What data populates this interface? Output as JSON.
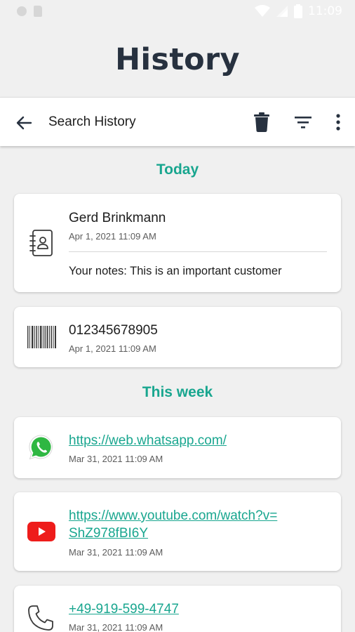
{
  "status_bar": {
    "time": "11:09"
  },
  "page": {
    "title": "History"
  },
  "toolbar": {
    "title": "Search History"
  },
  "sections": [
    {
      "header": "Today",
      "items": [
        {
          "icon": "contact-book-icon",
          "title": "Gerd Brinkmann",
          "date": "Apr 1, 2021 11:09 AM",
          "notes": "Your notes: This is an important customer"
        },
        {
          "icon": "barcode-icon",
          "title": "012345678905",
          "date": "Apr 1, 2021 11:09 AM"
        }
      ]
    },
    {
      "header": "This week",
      "items": [
        {
          "icon": "whatsapp-icon",
          "title": "https://web.whatsapp.com/",
          "date": "Mar 31, 2021 11:09 AM"
        },
        {
          "icon": "youtube-icon",
          "title_line1": "https://www.youtube.com/watch?v=",
          "title_line2": "ShZ978fBI6Y",
          "date": "Mar 31, 2021 11:09 AM"
        },
        {
          "icon": "phone-icon",
          "title": "+49-919-599-4747",
          "date": "Mar 31, 2021 11:09 AM"
        }
      ]
    }
  ],
  "colors": {
    "accent": "#19a68f",
    "title": "#27313f",
    "background": "#f0f0f0"
  }
}
